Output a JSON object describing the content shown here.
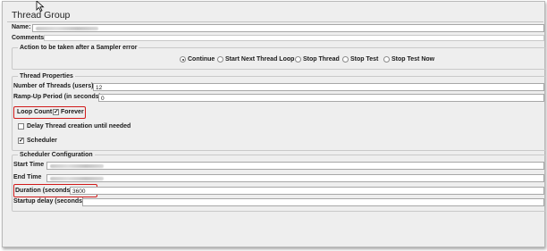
{
  "panel": {
    "title": "Thread Group",
    "name_label": "Name:",
    "comments_label": "Comments:"
  },
  "sampler_error": {
    "legend": "Action to be taken after a Sampler error",
    "options": [
      {
        "label": "Continue",
        "selected": true
      },
      {
        "label": "Start Next Thread Loop",
        "selected": false
      },
      {
        "label": "Stop Thread",
        "selected": false
      },
      {
        "label": "Stop Test",
        "selected": false
      },
      {
        "label": "Stop Test Now",
        "selected": false
      }
    ]
  },
  "thread_properties": {
    "legend": "Thread Properties",
    "threads_label": "Number of Threads (users):",
    "threads_value": "12",
    "rampup_label": "Ramp-Up Period (in seconds):",
    "rampup_value": "0",
    "loop_count_label": "Loop Count:",
    "forever_label": "Forever",
    "forever_checked": true,
    "delay_label": "Delay Thread creation until needed",
    "delay_checked": false,
    "scheduler_label": "Scheduler",
    "scheduler_checked": true
  },
  "scheduler": {
    "legend": "Scheduler Configuration",
    "start_label": "Start Time",
    "end_label": "End Time",
    "duration_label": "Duration (seconds)",
    "duration_value": "3600",
    "startup_label": "Startup delay (seconds)"
  },
  "colors": {
    "highlight": "#d11a1a",
    "panel_bg": "#eeeeee"
  },
  "icons": {
    "cursor": "mouse-pointer-icon"
  }
}
